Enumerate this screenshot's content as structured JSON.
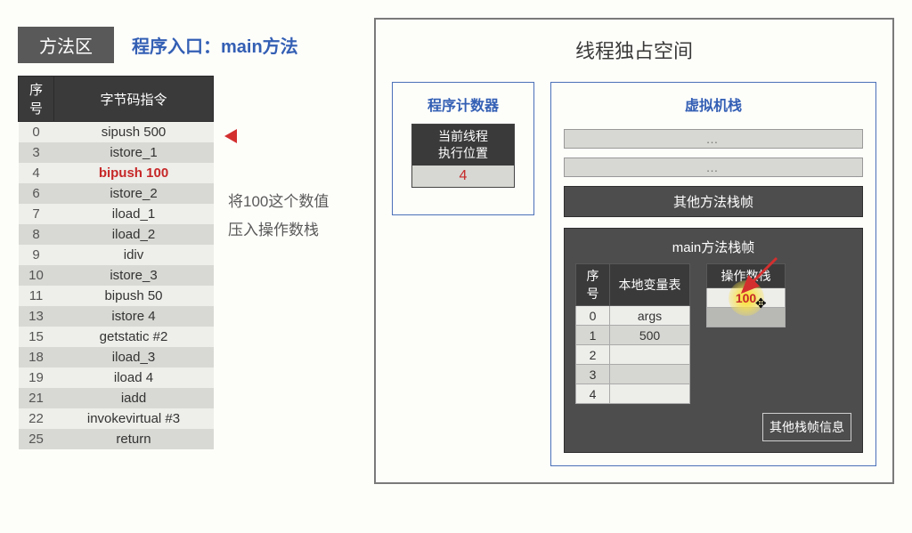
{
  "left": {
    "method_area_label": "方法区",
    "entry_label": "程序入口：main方法",
    "bytecode": {
      "headers": {
        "index": "序号",
        "instr": "字节码指令"
      },
      "rows": [
        {
          "idx": "0",
          "instr": "sipush 500"
        },
        {
          "idx": "3",
          "instr": "istore_1"
        },
        {
          "idx": "4",
          "instr": "bipush 100",
          "current": true
        },
        {
          "idx": "6",
          "instr": "istore_2"
        },
        {
          "idx": "7",
          "instr": "iload_1"
        },
        {
          "idx": "8",
          "instr": "iload_2"
        },
        {
          "idx": "9",
          "instr": "idiv"
        },
        {
          "idx": "10",
          "instr": "istore_3"
        },
        {
          "idx": "11",
          "instr": "bipush 50"
        },
        {
          "idx": "13",
          "instr": "istore 4"
        },
        {
          "idx": "15",
          "instr": "getstatic #2"
        },
        {
          "idx": "18",
          "instr": "iload_3"
        },
        {
          "idx": "19",
          "instr": "iload 4"
        },
        {
          "idx": "21",
          "instr": "iadd"
        },
        {
          "idx": "22",
          "instr": "invokevirtual #3"
        },
        {
          "idx": "25",
          "instr": "return"
        }
      ]
    },
    "annotation_line1": "将100这个数值",
    "annotation_line2": "压入操作数栈"
  },
  "right": {
    "thread_space_title": "线程独占空间",
    "pc": {
      "title": "程序计数器",
      "label_line1": "当前线程",
      "label_line2": "执行位置",
      "value": "4"
    },
    "vm": {
      "title": "虚拟机栈",
      "dots": "…",
      "other_frame_label": "其他方法栈帧",
      "main_frame_title": "main方法栈帧",
      "local_headers": {
        "index": "序号",
        "name": "本地变量表"
      },
      "local_rows": [
        {
          "idx": "0",
          "val": "args"
        },
        {
          "idx": "1",
          "val": "500"
        },
        {
          "idx": "2",
          "val": ""
        },
        {
          "idx": "3",
          "val": ""
        },
        {
          "idx": "4",
          "val": ""
        }
      ],
      "opstack_header": "操作数栈",
      "opstack_rows": [
        {
          "val": "100",
          "filled": true
        }
      ],
      "opstack_empty_rows": 1,
      "other_info_label": "其他栈帧信息"
    }
  }
}
